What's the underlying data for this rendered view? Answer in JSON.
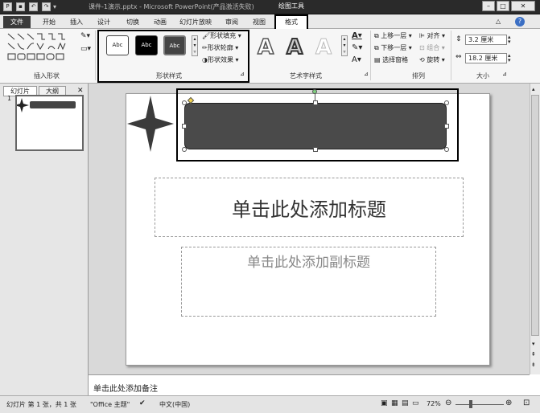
{
  "titlebar": {
    "document_title": "课件-1演示.pptx - Microsoft PowerPoint(产品激活失败)",
    "context_tool_label": "绘图工具",
    "undo_icon": "undo-icon",
    "redo_icon": "redo-icon"
  },
  "tabs": [
    "文件",
    "开始",
    "插入",
    "设计",
    "切换",
    "动画",
    "幻灯片放映",
    "审阅",
    "视图",
    "格式"
  ],
  "ribbon": {
    "insert_shapes_label": "插入形状",
    "shape_styles_label": "形状样式",
    "style_button_text": [
      "Abc",
      "Abc",
      "Abc"
    ],
    "fill_label": "形状填充",
    "outline_label": "形状轮廓",
    "effects_label": "形状效果",
    "wordart_label": "艺术字样式",
    "wordart_letter": "A",
    "arrange_label": "排列",
    "bring_forward": "上移一层",
    "send_backward": "下移一层",
    "selection_pane": "选择窗格",
    "align": "对齐",
    "group": "组合",
    "rotate": "旋转",
    "size_label": "大小",
    "height_value": "3.2 厘米",
    "width_value": "18.2 厘米"
  },
  "left_pane": {
    "tab_slides": "幻灯片",
    "tab_outline": "大纲",
    "close": "✕",
    "slide_number": "1"
  },
  "slide": {
    "title_placeholder": "单击此处添加标题",
    "subtitle_placeholder": "单击此处添加副标题"
  },
  "notes_placeholder": "单击此处添加备注",
  "status": {
    "slide_info": "幻灯片 第 1 张，共 1 张",
    "theme": "\"Office 主题\"",
    "language": "中文(中国)",
    "zoom": "72%"
  },
  "colors": {
    "title_bar": "#2a2a2a",
    "shape_fill": "#4a4a4a",
    "selection_highlight": "#000000"
  }
}
